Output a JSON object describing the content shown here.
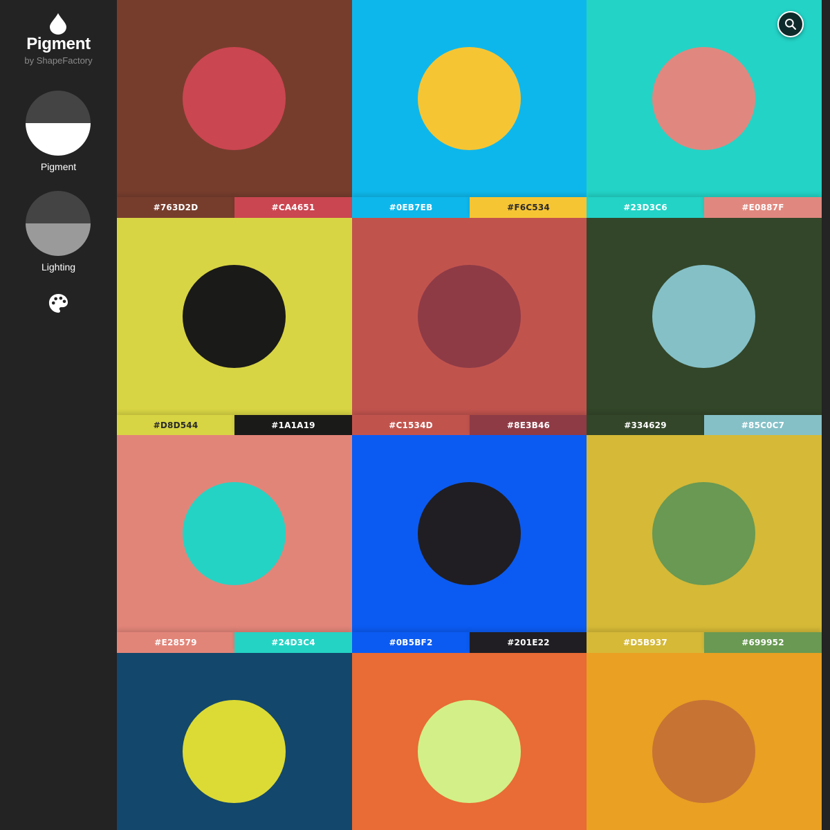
{
  "app": {
    "title": "Pigment",
    "subtitle": "by ShapeFactory",
    "icon": "drop-icon"
  },
  "sidebar": {
    "modes": [
      {
        "label": "Pigment",
        "top_color": "#444444",
        "bottom_color": "#ffffff"
      },
      {
        "label": "Lighting",
        "top_color": "#444444",
        "bottom_color": "#9a9a9a"
      }
    ],
    "palette_icon": "palette-icon"
  },
  "search": {
    "icon": "search-icon"
  },
  "palettes": [
    {
      "bg": "#763D2D",
      "circle": "#CA4651",
      "hex_bg": "#763D2D",
      "hex_circle": "#CA4651"
    },
    {
      "bg": "#0EB7EB",
      "circle": "#F6C534",
      "hex_bg": "#0EB7EB",
      "hex_circle": "#F6C534"
    },
    {
      "bg": "#23D3C6",
      "circle": "#E0887F",
      "hex_bg": "#23D3C6",
      "hex_circle": "#E0887F"
    },
    {
      "bg": "#D8D544",
      "circle": "#1A1A19",
      "hex_bg": "#D8D544",
      "hex_circle": "#1A1A19"
    },
    {
      "bg": "#C1534D",
      "circle": "#8E3B46",
      "hex_bg": "#C1534D",
      "hex_circle": "#8E3B46"
    },
    {
      "bg": "#334629",
      "circle": "#85C0C7",
      "hex_bg": "#334629",
      "hex_circle": "#85C0C7"
    },
    {
      "bg": "#E28579",
      "circle": "#24D3C4",
      "hex_bg": "#E28579",
      "hex_circle": "#24D3C4"
    },
    {
      "bg": "#0B5BF2",
      "circle": "#201E22",
      "hex_bg": "#0B5BF2",
      "hex_circle": "#201E22"
    },
    {
      "bg": "#D5B937",
      "circle": "#699952",
      "hex_bg": "#D5B937",
      "hex_circle": "#699952"
    },
    {
      "bg": "#13476B",
      "circle": "#DCDB35",
      "hex_bg": "",
      "hex_circle": ""
    },
    {
      "bg": "#E96B35",
      "circle": "#D2F087",
      "hex_bg": "",
      "hex_circle": ""
    },
    {
      "bg": "#E9A023",
      "circle": "#C77334",
      "hex_bg": "",
      "hex_circle": ""
    }
  ]
}
